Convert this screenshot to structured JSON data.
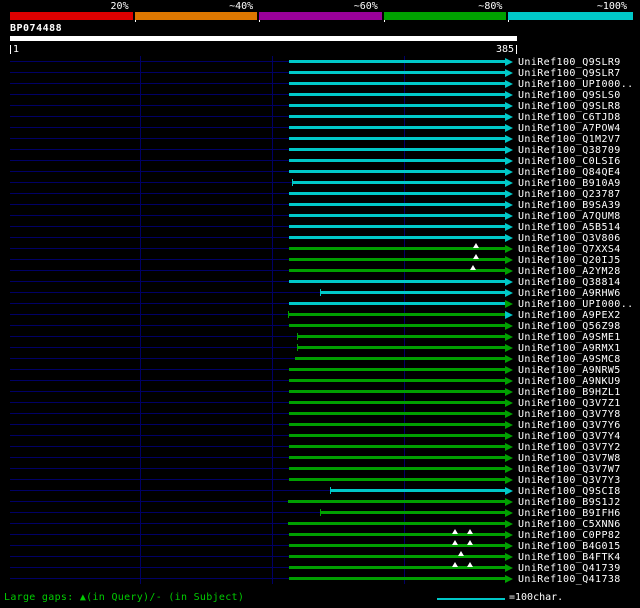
{
  "header": {
    "identity_scale": {
      "labels": [
        "20%",
        "~40%",
        "~60%",
        "~80%",
        "~100%"
      ],
      "colors": [
        "#dd0000",
        "#dd7700",
        "#990099",
        "#00a000",
        "#00c8c8"
      ]
    },
    "query_name": "BP074488",
    "ruler": {
      "start": "1",
      "end": "385"
    }
  },
  "colors": {
    "background": "#000000",
    "cyan": "#00c8c8",
    "green": "#00a000",
    "grid": "#000066",
    "text": "#ffffff",
    "legend_text": "#00cc00",
    "gap_marker": "#ffffff",
    "query_bar": "#ffffff"
  },
  "footer": {
    "gaps_legend": "Large gaps: ▲(in Query)/- (in Subject)",
    "scalebar_label": "=100char."
  },
  "chart_data": {
    "type": "bar",
    "orientation": "horizontal",
    "title": "BP074488",
    "xlim": [
      1,
      385
    ],
    "gridlines": [
      100,
      200,
      300
    ],
    "legend": {
      "color_meaning": {
        "cyan": "~100% identity",
        "green": "~80% identity"
      },
      "gap_marker": "▲ large gap in Query"
    },
    "bars": [
      {
        "label": "UniRef100_Q9SLR9",
        "start": 213,
        "end": 385,
        "color": "cyan",
        "identity": "~100%"
      },
      {
        "label": "UniRef100_Q9SLR7",
        "start": 213,
        "end": 385,
        "color": "cyan",
        "identity": "~100%"
      },
      {
        "label": "UniRef100_UPI000..",
        "start": 213,
        "end": 385,
        "color": "cyan",
        "identity": "~100%"
      },
      {
        "label": "UniRef100_Q9SLS0",
        "start": 213,
        "end": 385,
        "color": "cyan",
        "identity": "~100%"
      },
      {
        "label": "UniRef100_Q9SLR8",
        "start": 213,
        "end": 385,
        "color": "cyan",
        "identity": "~100%"
      },
      {
        "label": "UniRef100_C6TJD8",
        "start": 213,
        "end": 385,
        "color": "cyan",
        "identity": "~100%"
      },
      {
        "label": "UniRef100_A7POW4",
        "start": 213,
        "end": 385,
        "color": "cyan",
        "identity": "~100%"
      },
      {
        "label": "UniRef100_Q1M2V7",
        "start": 213,
        "end": 385,
        "color": "cyan",
        "identity": "~100%"
      },
      {
        "label": "UniRef100_Q38709",
        "start": 213,
        "end": 385,
        "color": "cyan",
        "identity": "~100%"
      },
      {
        "label": "UniRef100_C0LSI6",
        "start": 213,
        "end": 385,
        "color": "cyan",
        "identity": "~100%"
      },
      {
        "label": "UniRef100_Q84QE4",
        "start": 213,
        "end": 385,
        "color": "cyan",
        "identity": "~100%"
      },
      {
        "label": "UniRef100_B910A9",
        "start": 215,
        "end": 385,
        "color": "cyan",
        "identity": "~100%",
        "start_tick": true
      },
      {
        "label": "UniRef100_Q23787",
        "start": 213,
        "end": 385,
        "color": "cyan",
        "identity": "~100%"
      },
      {
        "label": "UniRef100_B9SA39",
        "start": 213,
        "end": 385,
        "color": "cyan",
        "identity": "~100%"
      },
      {
        "label": "UniRef100_A7QUM8",
        "start": 213,
        "end": 385,
        "color": "cyan",
        "identity": "~100%"
      },
      {
        "label": "UniRef100_A5B514",
        "start": 213,
        "end": 385,
        "color": "cyan",
        "identity": "~100%"
      },
      {
        "label": "UniRef100_Q3V806",
        "start": 213,
        "end": 385,
        "color": "cyan",
        "identity": "~100%"
      },
      {
        "label": "UniRef100_Q7XXS4",
        "start": 213,
        "end": 385,
        "color": "green",
        "identity": "~80%",
        "gap_markers": [
          355
        ]
      },
      {
        "label": "UniRef100_Q20IJ5",
        "start": 213,
        "end": 385,
        "color": "green",
        "identity": "~80%",
        "gap_markers": [
          355
        ]
      },
      {
        "label": "UniRef100_A2YM28",
        "start": 213,
        "end": 385,
        "color": "green",
        "identity": "~80%",
        "gap_markers": [
          352
        ]
      },
      {
        "label": "UniRef100_Q38814",
        "start": 213,
        "end": 385,
        "color": "cyan",
        "identity": "~100%"
      },
      {
        "label": "UniRef100_A9RHW6",
        "start": 236,
        "end": 385,
        "color": "cyan",
        "identity": "~100%",
        "start_tick": true
      },
      {
        "label": "UniRef100_UPI000..",
        "start": 213,
        "end": 385,
        "color": "cyan",
        "identity": "~100%",
        "arrow_color": "green"
      },
      {
        "label": "UniRef100_A9PEX2",
        "start": 212,
        "end": 385,
        "color": "green",
        "identity": "~80%",
        "start_tick": true,
        "arrow_color": "cyan"
      },
      {
        "label": "UniRef100_Q56Z98",
        "start": 213,
        "end": 385,
        "color": "green",
        "identity": "~80%"
      },
      {
        "label": "UniRef100_A9SME1",
        "start": 219,
        "end": 385,
        "color": "green",
        "identity": "~80%",
        "start_tick": true
      },
      {
        "label": "UniRef100_A9RMX1",
        "start": 219,
        "end": 385,
        "color": "green",
        "identity": "~80%",
        "start_tick": true
      },
      {
        "label": "UniRef100_A9SMC8",
        "start": 217,
        "end": 385,
        "color": "green",
        "identity": "~80%"
      },
      {
        "label": "UniRef100_A9NRW5",
        "start": 213,
        "end": 385,
        "color": "green",
        "identity": "~80%"
      },
      {
        "label": "UniRef100_A9NKU9",
        "start": 213,
        "end": 385,
        "color": "green",
        "identity": "~80%"
      },
      {
        "label": "UniRef100_B9HZL1",
        "start": 213,
        "end": 385,
        "color": "green",
        "identity": "~80%"
      },
      {
        "label": "UniRef100_Q3V7Z1",
        "start": 213,
        "end": 385,
        "color": "green",
        "identity": "~80%"
      },
      {
        "label": "UniRef100_Q3V7Y8",
        "start": 213,
        "end": 385,
        "color": "green",
        "identity": "~80%"
      },
      {
        "label": "UniRef100_Q3V7Y6",
        "start": 213,
        "end": 385,
        "color": "green",
        "identity": "~80%"
      },
      {
        "label": "UniRef100_Q3V7Y4",
        "start": 213,
        "end": 385,
        "color": "green",
        "identity": "~80%"
      },
      {
        "label": "UniRef100_Q3V7Y2",
        "start": 213,
        "end": 385,
        "color": "green",
        "identity": "~80%"
      },
      {
        "label": "UniRef100_Q3V7W8",
        "start": 213,
        "end": 385,
        "color": "green",
        "identity": "~80%"
      },
      {
        "label": "UniRef100_Q3V7W7",
        "start": 213,
        "end": 385,
        "color": "green",
        "identity": "~80%"
      },
      {
        "label": "UniRef100_Q3V7Y3",
        "start": 213,
        "end": 385,
        "color": "green",
        "identity": "~80%"
      },
      {
        "label": "UniRef100_Q9SCI8",
        "start": 244,
        "end": 385,
        "color": "cyan",
        "identity": "~100%",
        "start_tick": true
      },
      {
        "label": "UniRef100_B9S1J2",
        "start": 212,
        "end": 385,
        "color": "green",
        "identity": "~80%"
      },
      {
        "label": "UniRef100_B9IFH6",
        "start": 236,
        "end": 385,
        "color": "green",
        "identity": "~80%",
        "start_tick": true
      },
      {
        "label": "UniRef100_C5XNN6",
        "start": 212,
        "end": 385,
        "color": "green",
        "identity": "~80%"
      },
      {
        "label": "UniRef100_C0PP82",
        "start": 213,
        "end": 385,
        "color": "green",
        "identity": "~80%",
        "gap_markers": [
          339,
          350
        ]
      },
      {
        "label": "UniRef100_B4G015",
        "start": 213,
        "end": 385,
        "color": "green",
        "identity": "~80%",
        "gap_markers": [
          339,
          350
        ]
      },
      {
        "label": "UniRef100_B4FTK4",
        "start": 213,
        "end": 385,
        "color": "green",
        "identity": "~80%",
        "gap_markers": [
          343
        ]
      },
      {
        "label": "UniRef100_Q41739",
        "start": 213,
        "end": 385,
        "color": "green",
        "identity": "~80%",
        "gap_markers": [
          339,
          350
        ]
      },
      {
        "label": "UniRef100_Q41738",
        "start": 213,
        "end": 385,
        "color": "green",
        "identity": "~80%"
      }
    ]
  }
}
